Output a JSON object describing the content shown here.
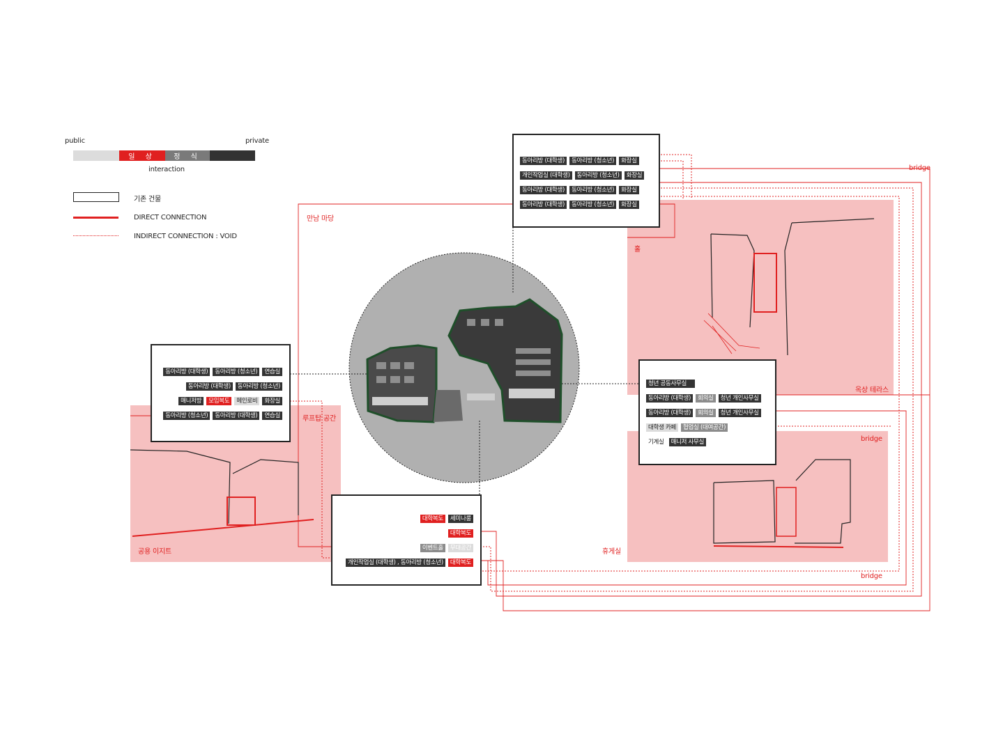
{
  "legend": {
    "public": "public",
    "private": "private",
    "bar_1": "일 상",
    "bar_2": "정 식",
    "interaction": "interaction",
    "existing_building": "기존 건물",
    "direct": "DIRECT CONNECTION",
    "indirect": "INDIRECT CONNECTION : VOID"
  },
  "colors": {
    "accent": "#e02020",
    "pink_area": "#f6c0c0",
    "tag_dark": "#333333",
    "circle": "#b0b0b0"
  },
  "labels": {
    "madang": "만남 마당",
    "hall": "홀",
    "bridge_top": "bridge",
    "rooftop_terrace": "옥상 테라스",
    "bridge_mid": "bridge",
    "rooftop_space": "루프탑 공간",
    "public_exit": "공용 이지트",
    "lounge": "휴게실",
    "bridge_bottom": "bridge"
  },
  "box_top": [
    [
      "동아리방 (대학생)",
      "동아리방 (청소년)",
      "화장실"
    ],
    [
      "개인작업실 (대학생)",
      "동아리방 (청소년)",
      "화장실"
    ],
    [
      "동아리방 (대학생)",
      "동아리방 (청소년)",
      "화장실"
    ],
    [
      "동아리방 (대학생)",
      "동아리방 (청소년)",
      "화장실"
    ]
  ],
  "box_left": [
    [
      "동아리방 (대학생)",
      "동아리방 (청소년)",
      "연습실"
    ],
    [
      "동아리방 (대학생)",
      "동아리방 (청소년)"
    ],
    [
      "매니저방",
      "모임복도",
      "메인로비",
      "화장실"
    ],
    [
      "동아리방 (청소년)",
      "동아리방 (대학생)",
      "연습실"
    ]
  ],
  "box_right": [
    [
      "청년 공동사무실"
    ],
    [
      "동아리방 (대학생)",
      "회의실",
      "청년 개인사무실"
    ],
    [
      "동아리방 (대학생)",
      "회의실",
      "청년 개인사무실"
    ],
    [
      "대학생 카페",
      "협업실 (대여공간)"
    ],
    [
      "기계실",
      "매니저 사무실"
    ]
  ],
  "box_bottom": [
    [
      "대학복도",
      "세미나룸"
    ],
    [
      "대학복도"
    ],
    [
      "이벤트홀",
      "무대공간"
    ],
    [
      "개인작업실 (대학생) , 동아리방 (청소년)",
      "대학복도"
    ]
  ]
}
